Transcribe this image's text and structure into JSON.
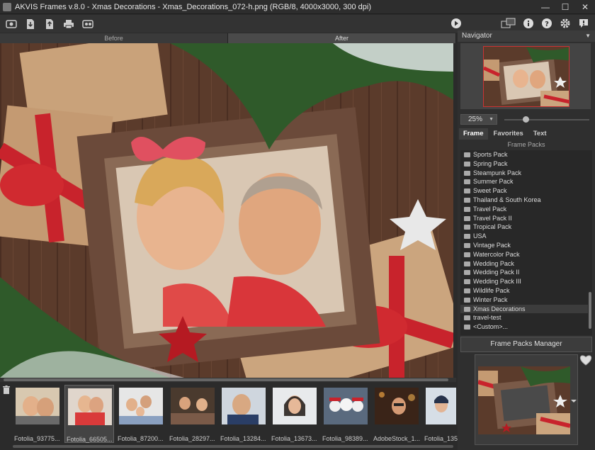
{
  "window": {
    "title": "AKVIS Frames v.8.0 - Xmas Decorations - Xmas_Decorations_072-h.png (RGB/8, 4000x3000, 300 dpi)",
    "controls": [
      "minimize-icon",
      "maximize-icon",
      "close-icon"
    ]
  },
  "toolbar": {
    "left_icons": [
      "open-image-icon",
      "import-icon",
      "export-icon",
      "print-icon",
      "batch-icon"
    ],
    "right_icons": [
      "run-icon",
      "workspace-icon",
      "info-icon",
      "help-icon",
      "settings-icon",
      "feedback-icon"
    ]
  },
  "view_tabs": {
    "before": "Before",
    "after": "After",
    "active": "After"
  },
  "filmstrip": {
    "items": [
      {
        "label": "Fotolia_93775..."
      },
      {
        "label": "Fotolia_66505..."
      },
      {
        "label": "Fotolia_87200..."
      },
      {
        "label": "Fotolia_28297..."
      },
      {
        "label": "Fotolia_13284..."
      },
      {
        "label": "Fotolia_13673..."
      },
      {
        "label": "Fotolia_98389..."
      },
      {
        "label": "AdobeStock_1..."
      },
      {
        "label": "Fotolia_135"
      }
    ],
    "selected_index": 1
  },
  "navigator": {
    "title": "Navigator",
    "zoom": "25%"
  },
  "panel_tabs": {
    "frame": "Frame",
    "favorites": "Favorites",
    "text": "Text",
    "active": "Frame"
  },
  "frame_packs": {
    "title": "Frame Packs",
    "items": [
      "Sports Pack",
      "Spring Pack",
      "Steampunk Pack",
      "Summer Pack",
      "Sweet Pack",
      "Thailand & South Korea",
      "Travel Pack",
      "Travel Pack II",
      "Tropical Pack",
      "USA",
      "Vintage Pack",
      "Watercolor Pack",
      "Wedding Pack",
      "Wedding Pack II",
      "Wedding Pack III",
      "Wildlife Pack",
      "Winter Pack",
      "Xmas Decorations",
      "travel-test",
      "<Custom>..."
    ],
    "selected": "Xmas Decorations",
    "manager_button": "Frame Packs Manager"
  },
  "colors": {
    "background": "#2b2b2b",
    "panel": "#2f2f2f",
    "accent_red": "#c8232c",
    "wood": "#5a3a2a"
  }
}
